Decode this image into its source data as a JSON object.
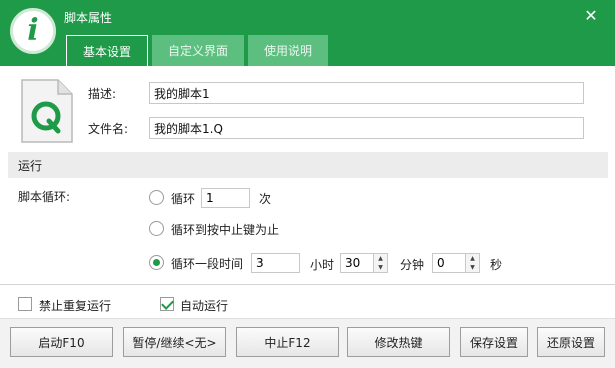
{
  "window": {
    "title": "脚本属性",
    "close": "✕"
  },
  "tabs": [
    {
      "label": "基本设置"
    },
    {
      "label": "自定义界面"
    },
    {
      "label": "使用说明"
    }
  ],
  "description": {
    "label": "描述:",
    "value": "我的脚本1"
  },
  "filename": {
    "label": "文件名:",
    "value": "我的脚本1.Q"
  },
  "section_run": {
    "label": "运行"
  },
  "loop": {
    "label": "脚本循环:",
    "option_count": {
      "label": "循环",
      "value": "1",
      "unit": "次",
      "selected": false
    },
    "option_until_stop": {
      "label": "循环到按中止键为止",
      "selected": false
    },
    "option_duration": {
      "label": "循环一段时间",
      "hours": "3",
      "hours_unit": "小时",
      "minutes": "30",
      "minutes_unit": "分钟",
      "seconds": "0",
      "seconds_unit": "秒",
      "selected": true
    }
  },
  "options": {
    "no_repeat": {
      "label": "禁止重复运行",
      "checked": false
    },
    "auto_run": {
      "label": "自动运行",
      "checked": true
    }
  },
  "buttons": {
    "start": "启动F10",
    "pause": "暂停/继续<无>",
    "stop": "中止F12",
    "hotkey": "修改热键",
    "save": "保存设置",
    "restore": "还原设置"
  },
  "colors": {
    "accent": "#1e9a48"
  }
}
